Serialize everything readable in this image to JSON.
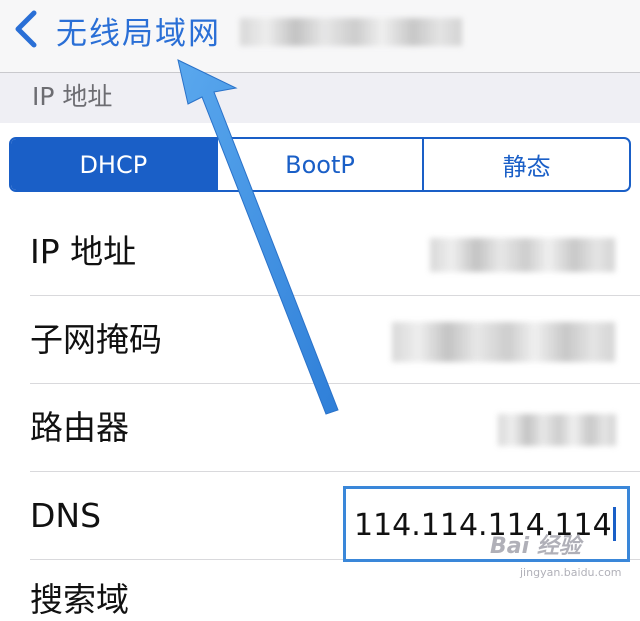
{
  "nav": {
    "back_label": "无线局域网"
  },
  "section": {
    "title": "IP 地址"
  },
  "segments": [
    "DHCP",
    "BootP",
    "静态"
  ],
  "rows": [
    {
      "label": "IP 地址",
      "value": ""
    },
    {
      "label": "子网掩码",
      "value": ""
    },
    {
      "label": "路由器",
      "value": ""
    },
    {
      "label": "DNS",
      "value": "114.114.114.114"
    }
  ],
  "next_row_label": "搜索域",
  "colors": {
    "accent": "#1a5fc7",
    "arrow": "#3d8fe0"
  },
  "watermark": {
    "text": "Bai 经验",
    "sub": "jingyan.baidu.com"
  },
  "icons": {
    "back": "chevron-left-icon",
    "annotation": "annotation-arrow-icon"
  }
}
